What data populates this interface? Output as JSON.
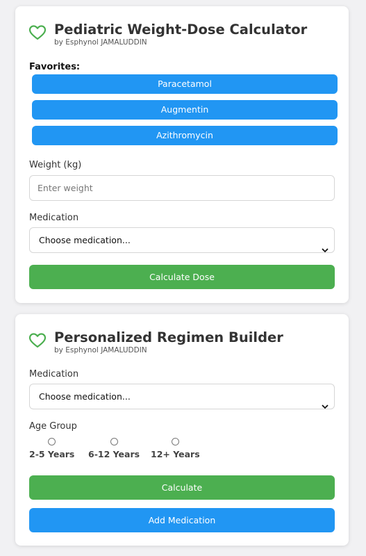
{
  "weight_calc": {
    "title": "Pediatric Weight-Dose Calculator",
    "byline": "by Esphynol JAMALUDDIN",
    "favorites_label": "Favorites:",
    "favorites": [
      "Paracetamol",
      "Augmentin",
      "Azithromycin"
    ],
    "weight_label": "Weight (kg)",
    "weight_placeholder": "Enter weight",
    "weight_value": "",
    "medication_label": "Medication",
    "medication_selected": "Choose medication...",
    "calculate_label": "Calculate Dose"
  },
  "regimen_builder": {
    "title": "Personalized Regimen Builder",
    "byline": "by Esphynol JAMALUDDIN",
    "medication_label": "Medication",
    "medication_selected": "Choose medication...",
    "age_group_label": "Age Group",
    "age_groups": [
      "2-5 Years",
      "6-12 Years",
      "12+ Years"
    ],
    "calculate_label": "Calculate",
    "add_medication_label": "Add Medication"
  },
  "colors": {
    "accent_blue": "#2196f3",
    "accent_green": "#4caf50",
    "heart_outline": "#4caf50",
    "background": "#f1f1f3"
  },
  "icons": {
    "card_icon": "heart-outline-icon",
    "select_icon": "chevron-down-icon"
  }
}
